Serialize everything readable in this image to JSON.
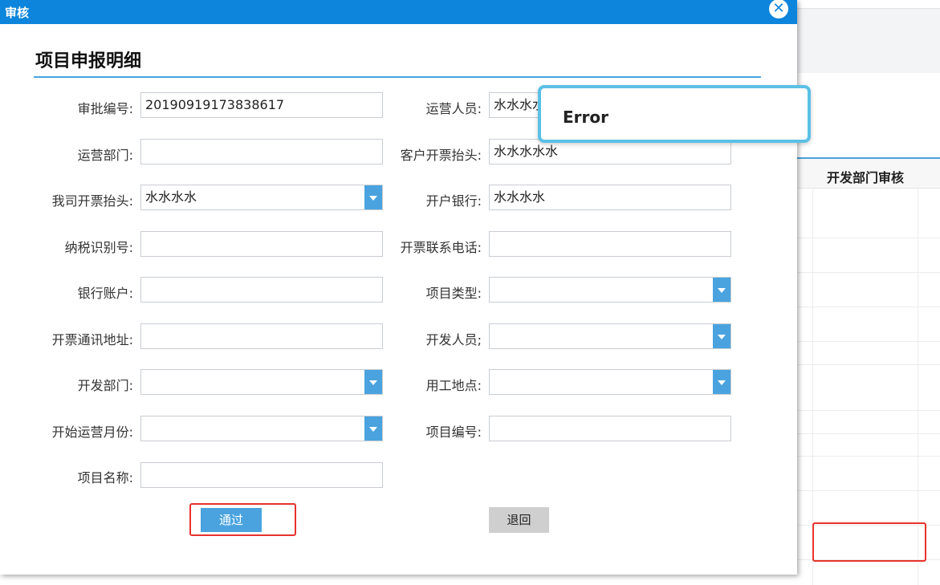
{
  "dialog": {
    "title": "审核",
    "close_icon": "close-icon"
  },
  "section": {
    "title": "项目申报明细"
  },
  "form": {
    "approval_no_label": "审批编号:",
    "approval_no_value": "20190919173838617",
    "operator_label": "运营人员:",
    "operator_value": "水水水水",
    "ops_dept_label": "运营部门:",
    "ops_dept_value": "",
    "customer_invoice_title_label": "客户开票抬头:",
    "customer_invoice_title_value": "水水水水水",
    "our_invoice_title_label": "我司开票抬头:",
    "our_invoice_title_value": "水水水水",
    "bank_label": "开户银行:",
    "bank_value": "水水水水",
    "tax_id_label": "纳税识别号:",
    "tax_id_value": "",
    "invoice_phone_label": "开票联系电话:",
    "invoice_phone_value": "",
    "bank_account_label": "银行账户:",
    "bank_account_value": "",
    "project_type_label": "项目类型:",
    "project_type_value": "",
    "invoice_address_label": "开票通讯地址:",
    "invoice_address_value": "",
    "developer_label": "开发人员;",
    "developer_value": "",
    "dev_dept_label": "开发部门:",
    "dev_dept_value": "",
    "work_location_label": "用工地点:",
    "work_location_value": "",
    "start_month_label": "开始运营月份:",
    "start_month_value": "",
    "project_no_label": "项目编号:",
    "project_no_value": "",
    "project_name_label": "项目名称:",
    "project_name_value": ""
  },
  "buttons": {
    "pass": "通过",
    "back": "退回"
  },
  "error_popup": {
    "text": "Error"
  },
  "background_table": {
    "column_header": "开发部门审核",
    "next_header_partial": ""
  },
  "colors": {
    "titlebar": "#0d85dc",
    "accent": "#4aa3df",
    "highlight_red": "#e8322b"
  }
}
